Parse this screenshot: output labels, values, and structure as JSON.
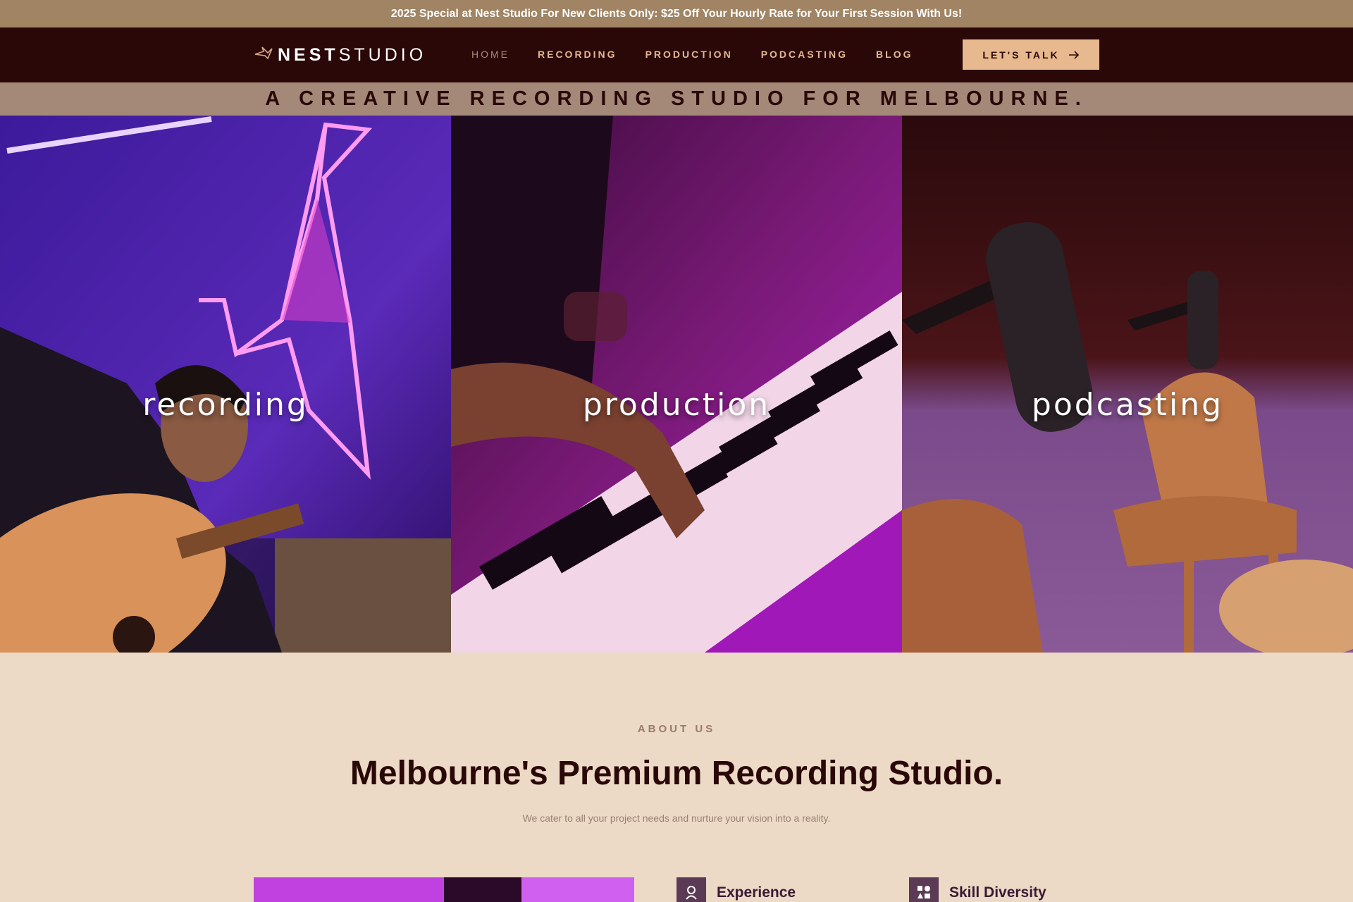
{
  "promo": {
    "text": "2025 Special at Nest Studio For New Clients Only: $25 Off Your Hourly Rate for Your First Session With Us!"
  },
  "header": {
    "logo_bold": "NEST",
    "logo_light": "STUDIO",
    "nav": [
      {
        "label": "HOME",
        "active": true
      },
      {
        "label": "RECORDING",
        "active": false
      },
      {
        "label": "PRODUCTION",
        "active": false
      },
      {
        "label": "PODCASTING",
        "active": false
      },
      {
        "label": "BLOG",
        "active": false
      }
    ],
    "cta_label": "LET'S TALK",
    "cta_icon": "arrow-right-icon"
  },
  "tagline": "A CREATIVE RECORDING STUDIO FOR MELBOURNE.",
  "hero": {
    "panels": [
      {
        "label": "recording",
        "image": "guitarist-neon-bird"
      },
      {
        "label": "production",
        "image": "hands-on-keyboard"
      },
      {
        "label": "podcasting",
        "image": "microphones-and-chair"
      }
    ]
  },
  "about": {
    "eyebrow": "ABOUT US",
    "title": "Melbourne's Premium Recording Studio.",
    "subtitle": "We cater to all your project needs and nurture your vision into a reality.",
    "features": [
      {
        "title": "Experience",
        "icon": "person-award-icon"
      },
      {
        "title": "Skill Diversity",
        "icon": "skills-grid-icon"
      }
    ]
  },
  "colors": {
    "promo_bg": "#a08464",
    "nav_bg": "#2a0808",
    "nav_link": "#e3b792",
    "cta_bg": "#e8b88e",
    "tagline_bg": "#a48878",
    "page_bg": "#ecd9c6",
    "heading": "#2a0808",
    "feature_icon_bg": "#5a3a55"
  }
}
